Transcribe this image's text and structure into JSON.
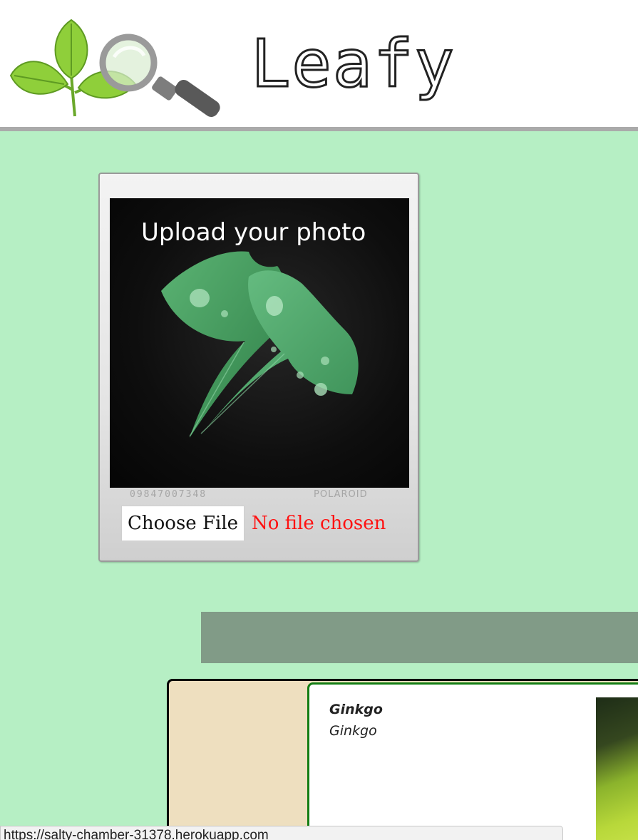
{
  "header": {
    "brand": "Leafy",
    "logo_icon": "leaf-magnifier-logo"
  },
  "upload": {
    "title": "Upload your photo",
    "film_code": "09847007348",
    "film_brand": "POLAROID",
    "choose_button": "Choose File",
    "file_status": "No file chosen"
  },
  "result": {
    "name": "Ginkgo",
    "scientific": "Ginkgo"
  },
  "statusbar": {
    "url": "https://salty-chamber-31378.herokuapp.com"
  },
  "colors": {
    "page_bg": "#b6efc4",
    "bar": "#819b87",
    "card_bg": "#eedfbf",
    "card_border_green": "#137d13",
    "status_red": "#ff1111"
  }
}
